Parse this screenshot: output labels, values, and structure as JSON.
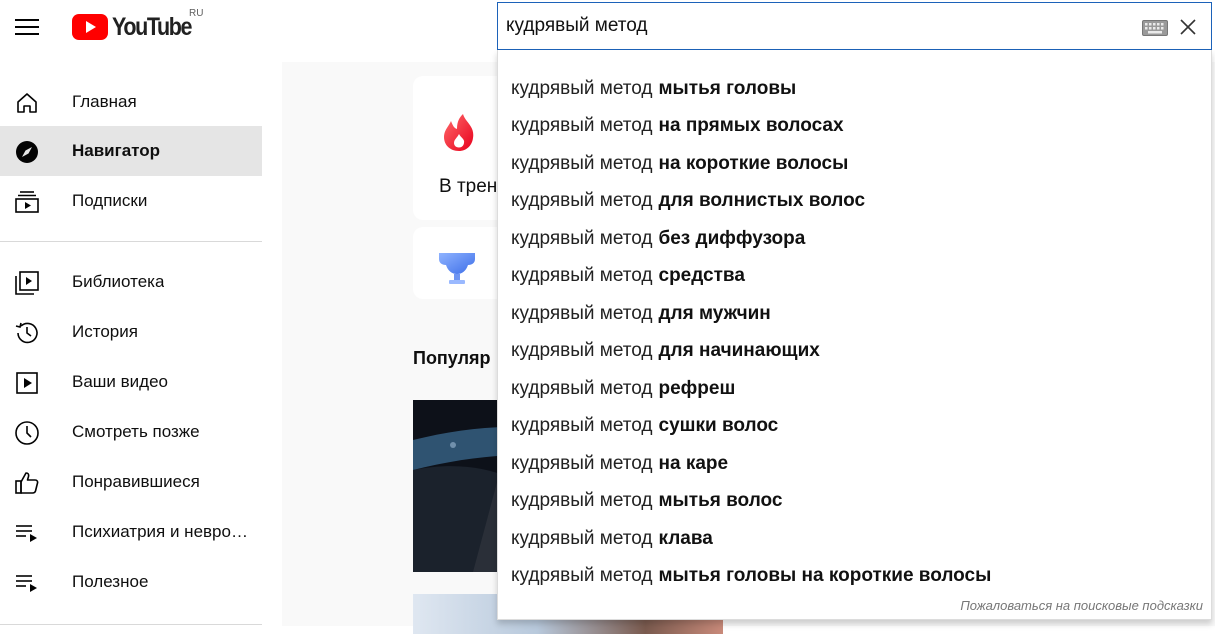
{
  "header": {
    "logo_text": "YouTube",
    "region": "RU",
    "search_value": "кудрявый метод"
  },
  "sidebar": {
    "items": [
      {
        "label": "Главная",
        "icon": "home-icon"
      },
      {
        "label": "Навигатор",
        "icon": "compass-icon",
        "active": true
      },
      {
        "label": "Подписки",
        "icon": "subscriptions-icon"
      },
      {
        "label": "Библиотека",
        "icon": "library-icon"
      },
      {
        "label": "История",
        "icon": "history-icon"
      },
      {
        "label": "Ваши видео",
        "icon": "your-videos-icon"
      },
      {
        "label": "Смотреть позже",
        "icon": "watch-later-icon"
      },
      {
        "label": "Понравившиеся",
        "icon": "like-icon"
      },
      {
        "label": "Психиатрия и невро…",
        "icon": "playlist-icon"
      },
      {
        "label": "Полезное",
        "icon": "playlist-icon"
      }
    ]
  },
  "main": {
    "trending_label": "В трен",
    "section_title": "Популяр"
  },
  "suggestions": {
    "prefix": "кудрявый метод",
    "items": [
      "мытья головы",
      "на прямых волосах",
      "на короткие волосы",
      "для волнистых волос",
      "без диффузора",
      "средства",
      "для мужчин",
      "для начинающих",
      "рефреш",
      "сушки волос",
      "на каре",
      "мытья волос",
      "клава",
      "мытья головы на короткие волосы"
    ],
    "report_label": "Пожаловаться на поисковые подсказки"
  },
  "colors": {
    "brand_red": "#ff0000",
    "search_border": "#1c62b9",
    "active_nav_bg": "#e5e5e5"
  }
}
